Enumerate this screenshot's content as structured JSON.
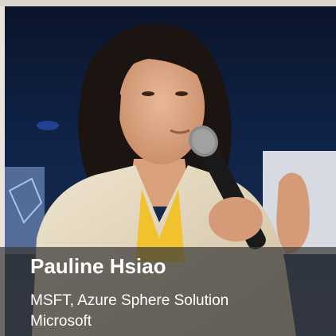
{
  "speaker": {
    "name": "Pauline Hsiao",
    "title": "MSFT, Azure Sphere Solution",
    "company": "Microsoft"
  },
  "colors": {
    "overlay": "#3a3a3ab8",
    "text": "#ffffff",
    "stage_background": "#0d1a33"
  }
}
